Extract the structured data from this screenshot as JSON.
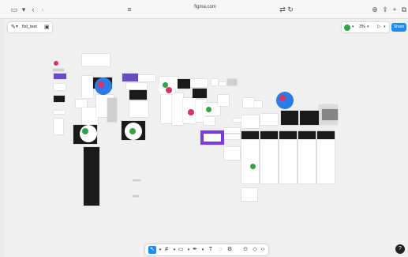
{
  "browser": {
    "url": "figma.com"
  },
  "figma": {
    "file_name": "fist_test",
    "zoom": "3%",
    "share_label": "Share",
    "help_label": "?"
  },
  "colors": {
    "accent": "#1f8cf5",
    "presence_green": "#2fa24a",
    "presence_blue": "#2d7be5",
    "presence_pink": "#d6336c",
    "purple_frame": "#7b3fd4"
  }
}
